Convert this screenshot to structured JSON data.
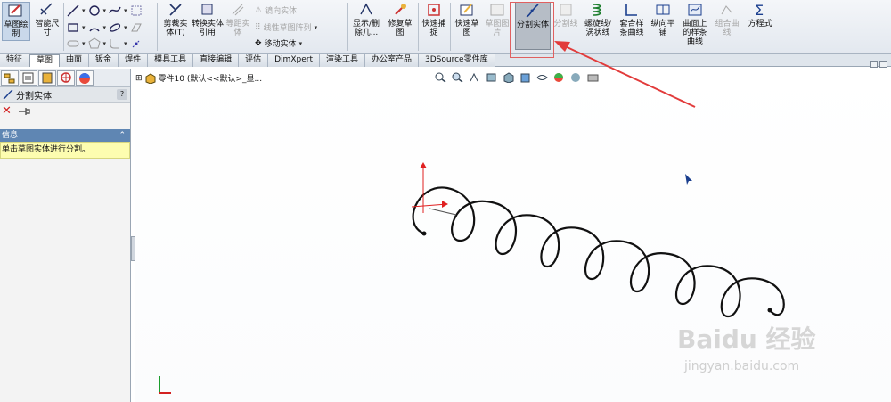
{
  "ribbon": {
    "sketch_label": "草图绘制",
    "smart_dim_label": "智能尺寸",
    "trim_label": "剪裁实体(T)",
    "convert_label": "转换实体引用",
    "offset_label": "等距实体",
    "mirror_label": "镜向实体",
    "linear_pattern_label": "线性草图阵列",
    "move_label": "移动实体",
    "display_delete_label": "显示/删除几...",
    "repair_label": "修复草图",
    "quick_snap_label": "快速捕捉",
    "rapid_sketch_label": "快速草图",
    "sketch_picture_label": "草图图片",
    "split_entities_label": "分割实体",
    "split_line_label": "分割线",
    "helix_label": "螺旋线/涡状线",
    "composite_curve_label": "套合样条曲线",
    "vertical_plane_label": "纵向平铺",
    "spline_on_surface_label": "曲面上的样条曲线",
    "composite_curve2_label": "组合曲线",
    "equation_label": "方程式"
  },
  "tabs": [
    {
      "label": "特征"
    },
    {
      "label": "草图"
    },
    {
      "label": "曲面"
    },
    {
      "label": "钣金"
    },
    {
      "label": "焊件"
    },
    {
      "label": "模具工具"
    },
    {
      "label": "直接编辑"
    },
    {
      "label": "评估"
    },
    {
      "label": "DimXpert"
    },
    {
      "label": "渲染工具"
    },
    {
      "label": "办公室产品"
    },
    {
      "label": "3DSource零件库"
    }
  ],
  "active_tab": "草图",
  "property_manager": {
    "title": "分割实体",
    "help": "?",
    "info_header": "信息",
    "info_text": "单击草图实体进行分割。"
  },
  "graphics": {
    "tree_node": "零件10  (默认<<默认>_显..."
  },
  "watermark": {
    "line1": "Baidu 经验",
    "line2": "jingyan.baidu.com"
  },
  "colors": {
    "accent_blue": "#5f86b3",
    "highlight_red": "#e06060",
    "info_yellow": "#fdfdb0"
  }
}
